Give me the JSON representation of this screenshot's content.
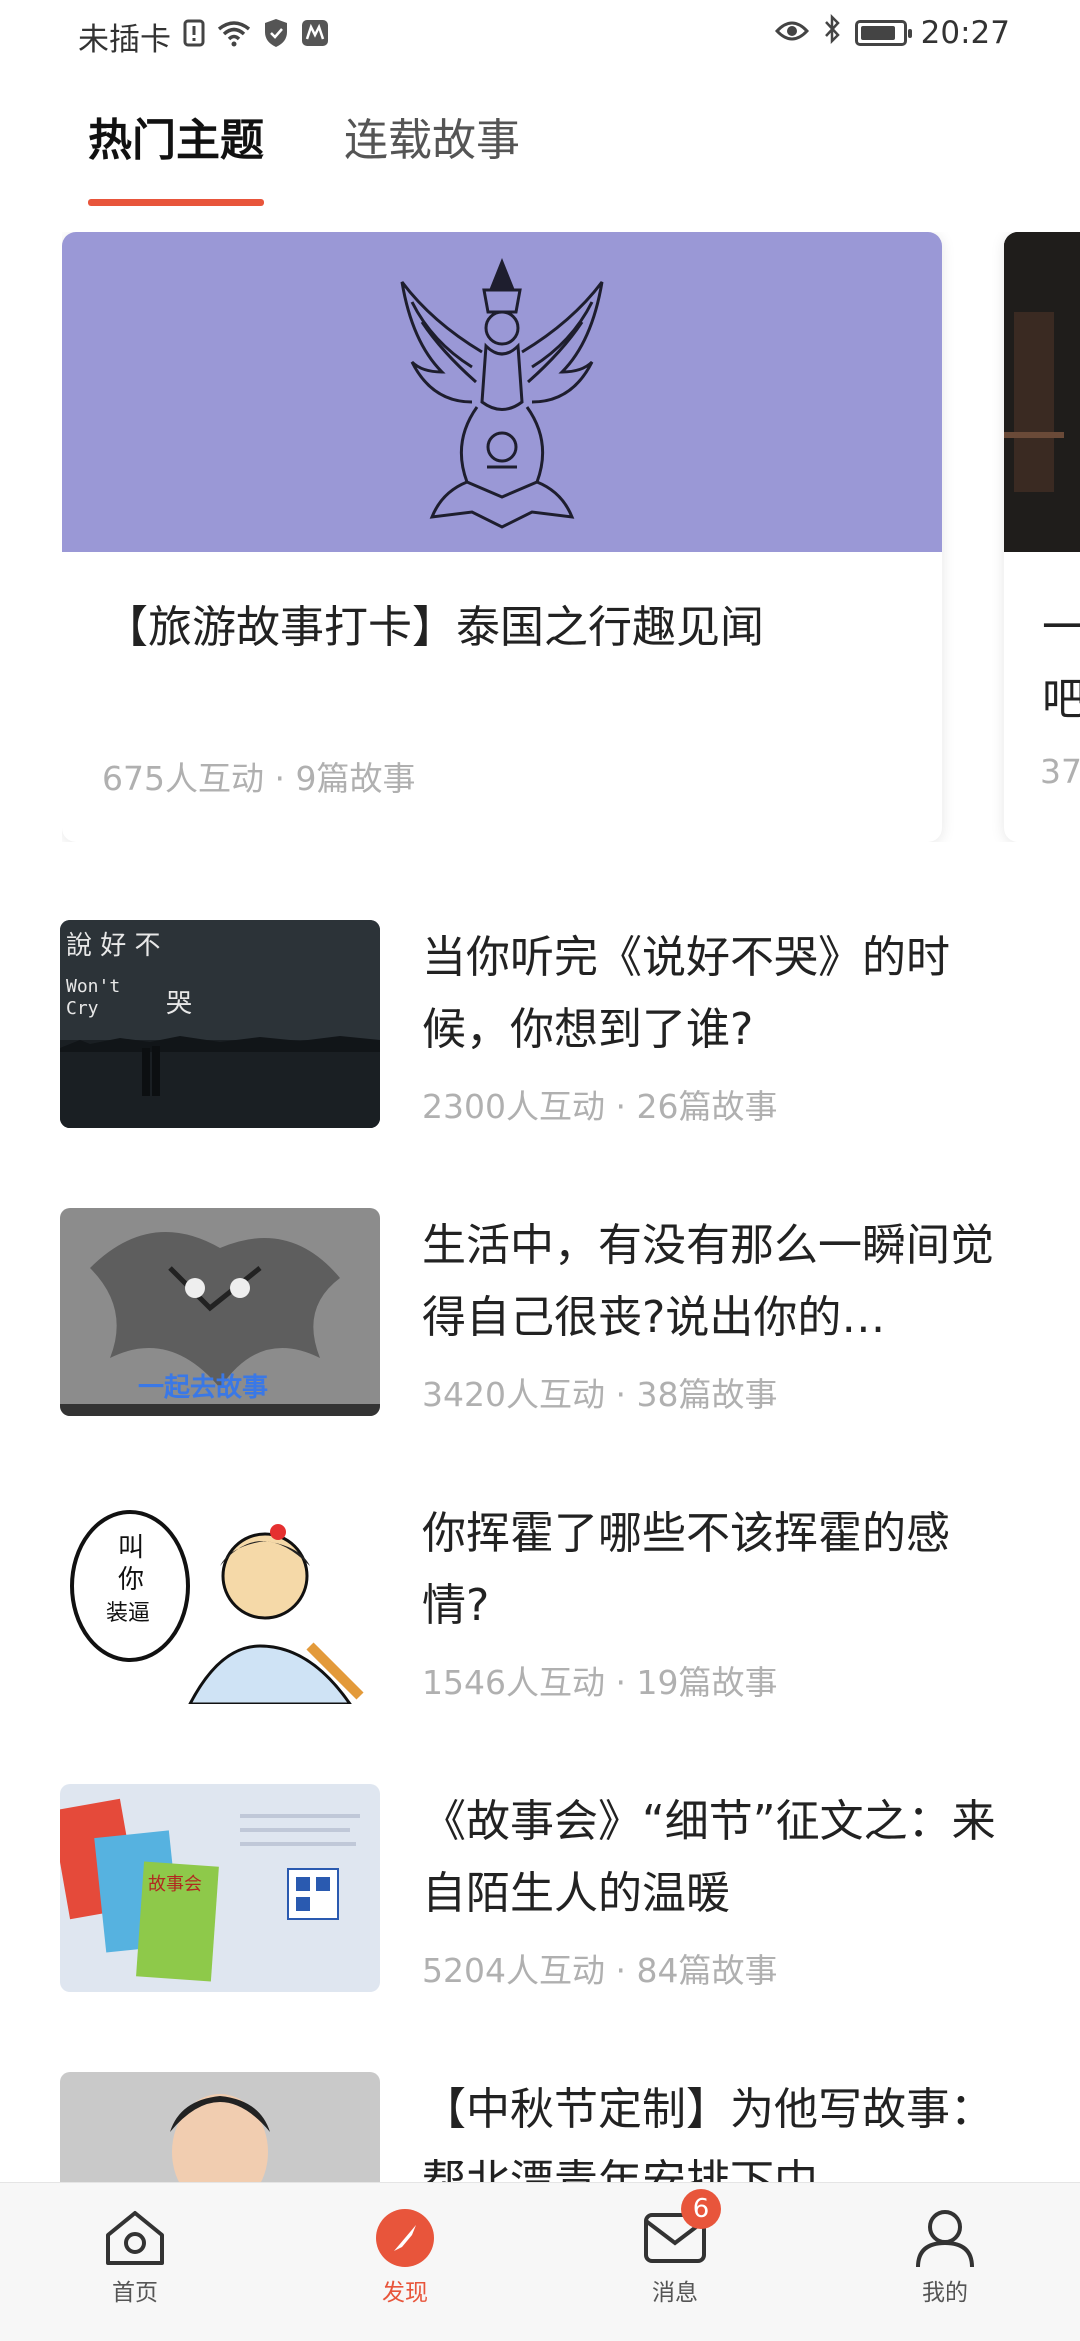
{
  "status_bar": {
    "carrier": "未插卡",
    "time": "20:27",
    "icons": [
      "sim-alert-icon",
      "wifi-icon",
      "shield-icon",
      "app-notification-icon",
      "eye-icon",
      "bluetooth-icon",
      "battery-icon"
    ]
  },
  "tabs": [
    {
      "label": "热门主题",
      "active": true
    },
    {
      "label": "连载故事",
      "active": false
    }
  ],
  "featured": [
    {
      "title": "【旅游故事打卡】泰国之行趣见闻",
      "meta": "675人互动 · 9篇故事",
      "image": "garuda-emblem"
    },
    {
      "title_line1": "一",
      "title_line2": "吧",
      "meta": "37",
      "image": "dark-photo"
    }
  ],
  "topics": [
    {
      "title": "当你听完《说好不哭》的时候，你想到了谁?",
      "meta": "2300人互动 · 26篇故事",
      "thumb": {
        "text1": "說 好 不",
        "text2": "Won't",
        "text3": "Cry",
        "text4": "哭"
      }
    },
    {
      "title": "生活中，有没有那么一瞬间觉得自己很丧?说出你的…",
      "meta": "3420人互动 · 38篇故事",
      "thumb": {
        "caption": "一起去故事"
      }
    },
    {
      "title": "你挥霍了哪些不该挥霍的感情?",
      "meta": "1546人互动 · 19篇故事",
      "thumb": {
        "bubble": "叫你装逼"
      }
    },
    {
      "title": "《故事会》“细节”征文之：来自陌生人的温暖",
      "meta": "5204人互动 · 84篇故事",
      "thumb": {
        "text": "故事会"
      }
    },
    {
      "title": "【中秋节定制】为他写故事：帮北漂青年安排下中…",
      "meta": "",
      "thumb": {}
    }
  ],
  "bottom_nav": [
    {
      "label": "首页",
      "icon": "home-icon",
      "active": false
    },
    {
      "label": "发现",
      "icon": "compass-icon",
      "active": true
    },
    {
      "label": "消息",
      "icon": "mail-icon",
      "active": false,
      "badge": "6"
    },
    {
      "label": "我的",
      "icon": "person-icon",
      "active": false
    }
  ],
  "colors": {
    "accent": "#e8553b",
    "meta_text": "#b0b0b0",
    "featured_bg": "#9a98d6"
  }
}
